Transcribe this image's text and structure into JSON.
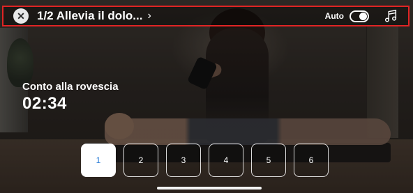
{
  "topbar": {
    "close_icon": "close-icon",
    "title": "1/2 Allevia il dolo...",
    "chevron": "›",
    "auto_label": "Auto",
    "auto_toggle_on": true,
    "music_icon": "music-note-icon"
  },
  "countdown": {
    "label": "Conto alla rovescia",
    "time": "02:34"
  },
  "steps": {
    "active_index": 0,
    "items": [
      "1",
      "2",
      "3",
      "4",
      "5",
      "6"
    ]
  }
}
